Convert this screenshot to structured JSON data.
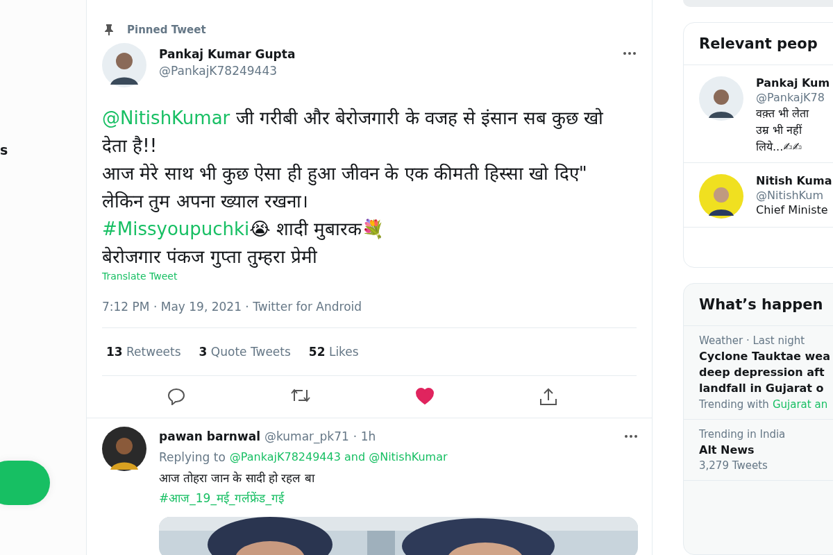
{
  "nav": {
    "item_label": "s"
  },
  "tweet": {
    "pinned_label": "Pinned Tweet",
    "name": "Pankaj Kumar Gupta",
    "handle": "@PankajK78249443",
    "body": [
      [
        {
          "kind": "link",
          "text": "@NitishKumar"
        },
        {
          "kind": "text",
          "text": " जी गरीबी और बेरोजगारी के वजह से इंसान सब कुछ खो देता है!!"
        }
      ],
      [
        {
          "kind": "text",
          "text": "आज मेरे साथ भी कुछ ऐसा ही हुआ जीवन के एक कीमती हिस्सा खो दिए\" लेकिन तुम अपना ख्याल रखना।"
        }
      ],
      [
        {
          "kind": "link",
          "text": "#Missyoupuchki"
        },
        {
          "kind": "text",
          "text": "😭 शादी मुबारक💐"
        }
      ],
      [
        {
          "kind": "text",
          "text": "बेरोजगार पंकज गुप्ता तुम्हरा प्रेमी"
        }
      ]
    ],
    "translate": "Translate Tweet",
    "meta": "7:12 PM · May 19, 2021 · Twitter for Android",
    "stats": [
      {
        "count": "13",
        "label": "Retweets"
      },
      {
        "count": "3",
        "label": "Quote Tweets"
      },
      {
        "count": "52",
        "label": "Likes"
      }
    ],
    "liked": true
  },
  "reply": {
    "name": "pawan barnwal",
    "handle": "@kumar_pk71",
    "time": "· 1h",
    "replying_label": "Replying to",
    "replying_links": "@PankajK78249443 and @NitishKumar",
    "text": "आज तोहरा जान के सादी हो रहल बा",
    "hashtag": "#आज_19_मई_गर्लफ्रेंड_गई"
  },
  "relevant_people": {
    "title": "Relevant peop",
    "people": [
      {
        "name": "Pankaj Kum",
        "handle": "@PankajK78",
        "bio": [
          "वक़्त भी लेता",
          "उम्र भी नहीं",
          "लिये...✍✍"
        ]
      },
      {
        "name": "Nitish Kuma",
        "handle": "@NitishKum",
        "bio": [
          "Chief Ministe"
        ]
      }
    ]
  },
  "trends": {
    "title": "What’s happen",
    "items": [
      {
        "context": "Weather · Last night",
        "headline": [
          "Cyclone Tauktae wea",
          "deep depression aft",
          "landfall in Gujarat o"
        ],
        "extra_label": "Trending with",
        "extra_link": "Gujarat an"
      },
      {
        "context": "Trending in India",
        "headline": [
          "Alt News"
        ],
        "count": "3,279 Tweets"
      }
    ]
  }
}
